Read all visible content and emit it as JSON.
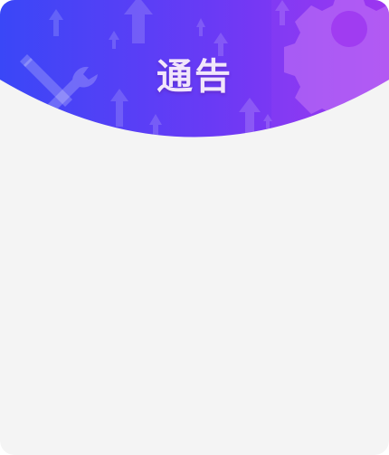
{
  "dialog": {
    "title": "通告",
    "body_text": ""
  },
  "colors": {
    "header_gradient_start": "#3a47f7",
    "header_gradient_end": "#9b32f0",
    "body_background": "#f4f4f4",
    "title_color": "#f1e6fb"
  },
  "icons": [
    "wrench-screwdriver-icon",
    "gear-icon",
    "arrow-up-icon"
  ]
}
